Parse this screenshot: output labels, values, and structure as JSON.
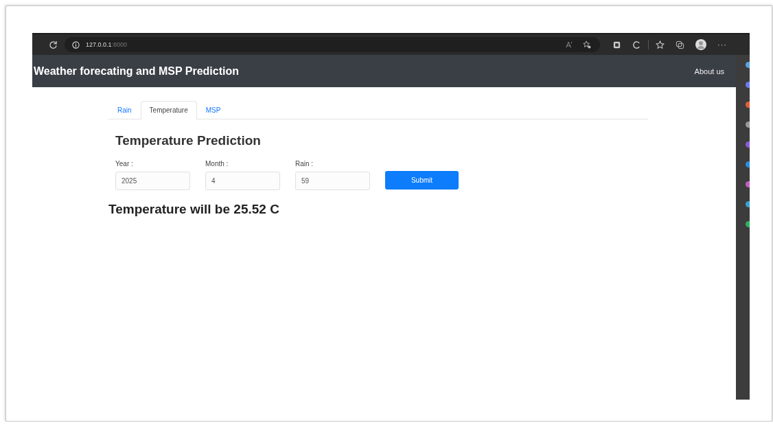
{
  "browser": {
    "url_host": "127.0.0.1",
    "url_port": ":8000"
  },
  "navbar": {
    "brand": "Weather forecating and MSP Prediction",
    "link": "About us"
  },
  "tabs": [
    {
      "label": "Rain",
      "selected": false
    },
    {
      "label": "Temperature",
      "selected": true
    },
    {
      "label": "MSP",
      "selected": false
    }
  ],
  "form": {
    "title": "Temperature Prediction",
    "fields": [
      {
        "label": "Year :",
        "value": "2025"
      },
      {
        "label": "Month :",
        "value": "4"
      },
      {
        "label": "Rain :",
        "value": "59"
      }
    ],
    "button": "Submit"
  },
  "result": "Temperature will be 25.52 C",
  "toolbar": {
    "more": "···"
  }
}
